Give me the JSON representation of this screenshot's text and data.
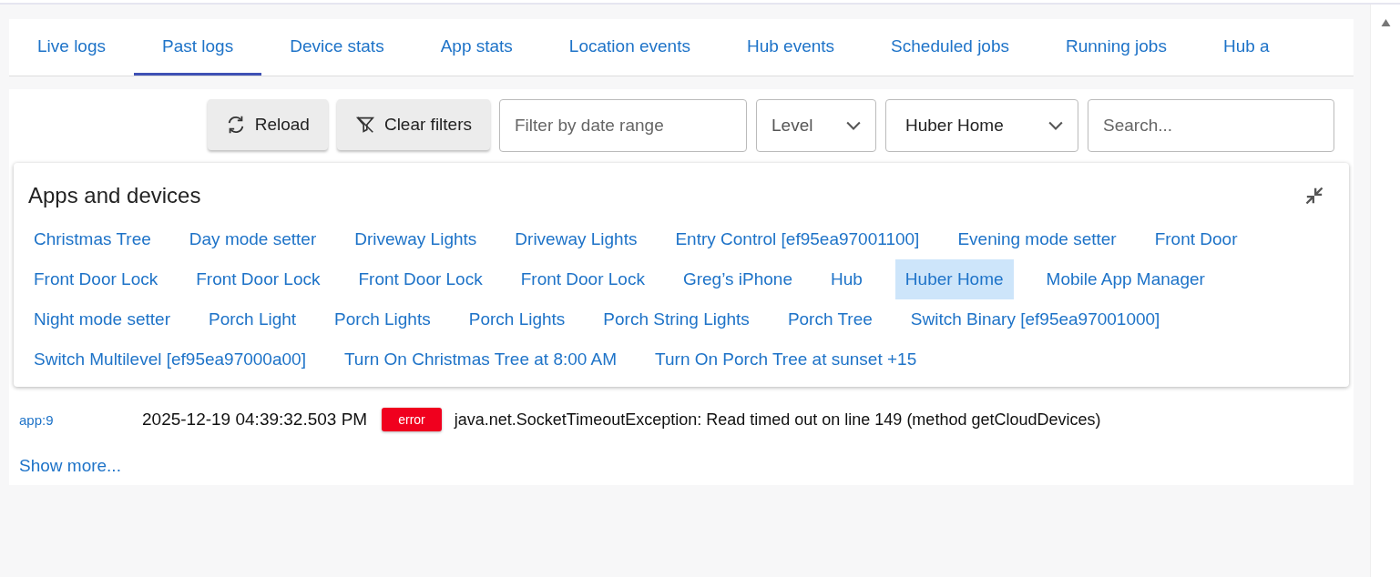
{
  "tabs": [
    {
      "label": "Live logs",
      "selected": false
    },
    {
      "label": "Past logs",
      "selected": true
    },
    {
      "label": "Device stats",
      "selected": false
    },
    {
      "label": "App stats",
      "selected": false
    },
    {
      "label": "Location events",
      "selected": false
    },
    {
      "label": "Hub events",
      "selected": false
    },
    {
      "label": "Scheduled jobs",
      "selected": false
    },
    {
      "label": "Running jobs",
      "selected": false
    },
    {
      "label": "Hub a",
      "selected": false
    }
  ],
  "toolbar": {
    "buttons": [
      {
        "label": "Reload",
        "kind": "reload"
      },
      {
        "label": "Clear filters",
        "kind": "clear"
      }
    ],
    "date_field": {
      "placeholder": "Filter by date range"
    },
    "level_select": {
      "placeholder": "Level"
    },
    "location_select": {
      "value": "Huber Home"
    },
    "search": {
      "placeholder": "Search..."
    }
  },
  "apps_panel": {
    "title": "Apps and devices",
    "items": [
      {
        "label": "Christmas Tree",
        "selected": false
      },
      {
        "label": "Day mode setter",
        "selected": false
      },
      {
        "label": "Driveway Lights",
        "selected": false
      },
      {
        "label": "Driveway Lights",
        "selected": false
      },
      {
        "label": "Entry Control [ef95ea97001100]",
        "selected": false
      },
      {
        "label": "Evening mode setter",
        "selected": false
      },
      {
        "label": "Front Door",
        "selected": false
      },
      {
        "label": "Front Door Lock",
        "selected": false
      },
      {
        "label": "Front Door Lock",
        "selected": false
      },
      {
        "label": "Front Door Lock",
        "selected": false
      },
      {
        "label": "Front Door Lock",
        "selected": false
      },
      {
        "label": "Greg’s iPhone",
        "selected": false
      },
      {
        "label": "Hub",
        "selected": false
      },
      {
        "label": "Huber Home",
        "selected": true
      },
      {
        "label": "Mobile App Manager",
        "selected": false
      },
      {
        "label": "Night mode setter",
        "selected": false
      },
      {
        "label": "Porch Light",
        "selected": false
      },
      {
        "label": "Porch Lights",
        "selected": false
      },
      {
        "label": "Porch Lights",
        "selected": false
      },
      {
        "label": "Porch String Lights",
        "selected": false
      },
      {
        "label": "Porch Tree",
        "selected": false
      },
      {
        "label": "Switch Binary [ef95ea97001000]",
        "selected": false
      },
      {
        "label": "Switch Multilevel [ef95ea97000a00]",
        "selected": false
      },
      {
        "label": "Turn On Christmas Tree at 8:00 AM",
        "selected": false
      },
      {
        "label": "Turn On Porch Tree at sunset +15",
        "selected": false
      }
    ]
  },
  "log_entries": [
    {
      "source": "app:9",
      "time": "2025-12-19 04:39:32.503 PM",
      "level": "error",
      "message": "java.net.SocketTimeoutException: Read timed out on line 149 (method getCloudDevices)"
    }
  ],
  "show_more": "Show more..."
}
